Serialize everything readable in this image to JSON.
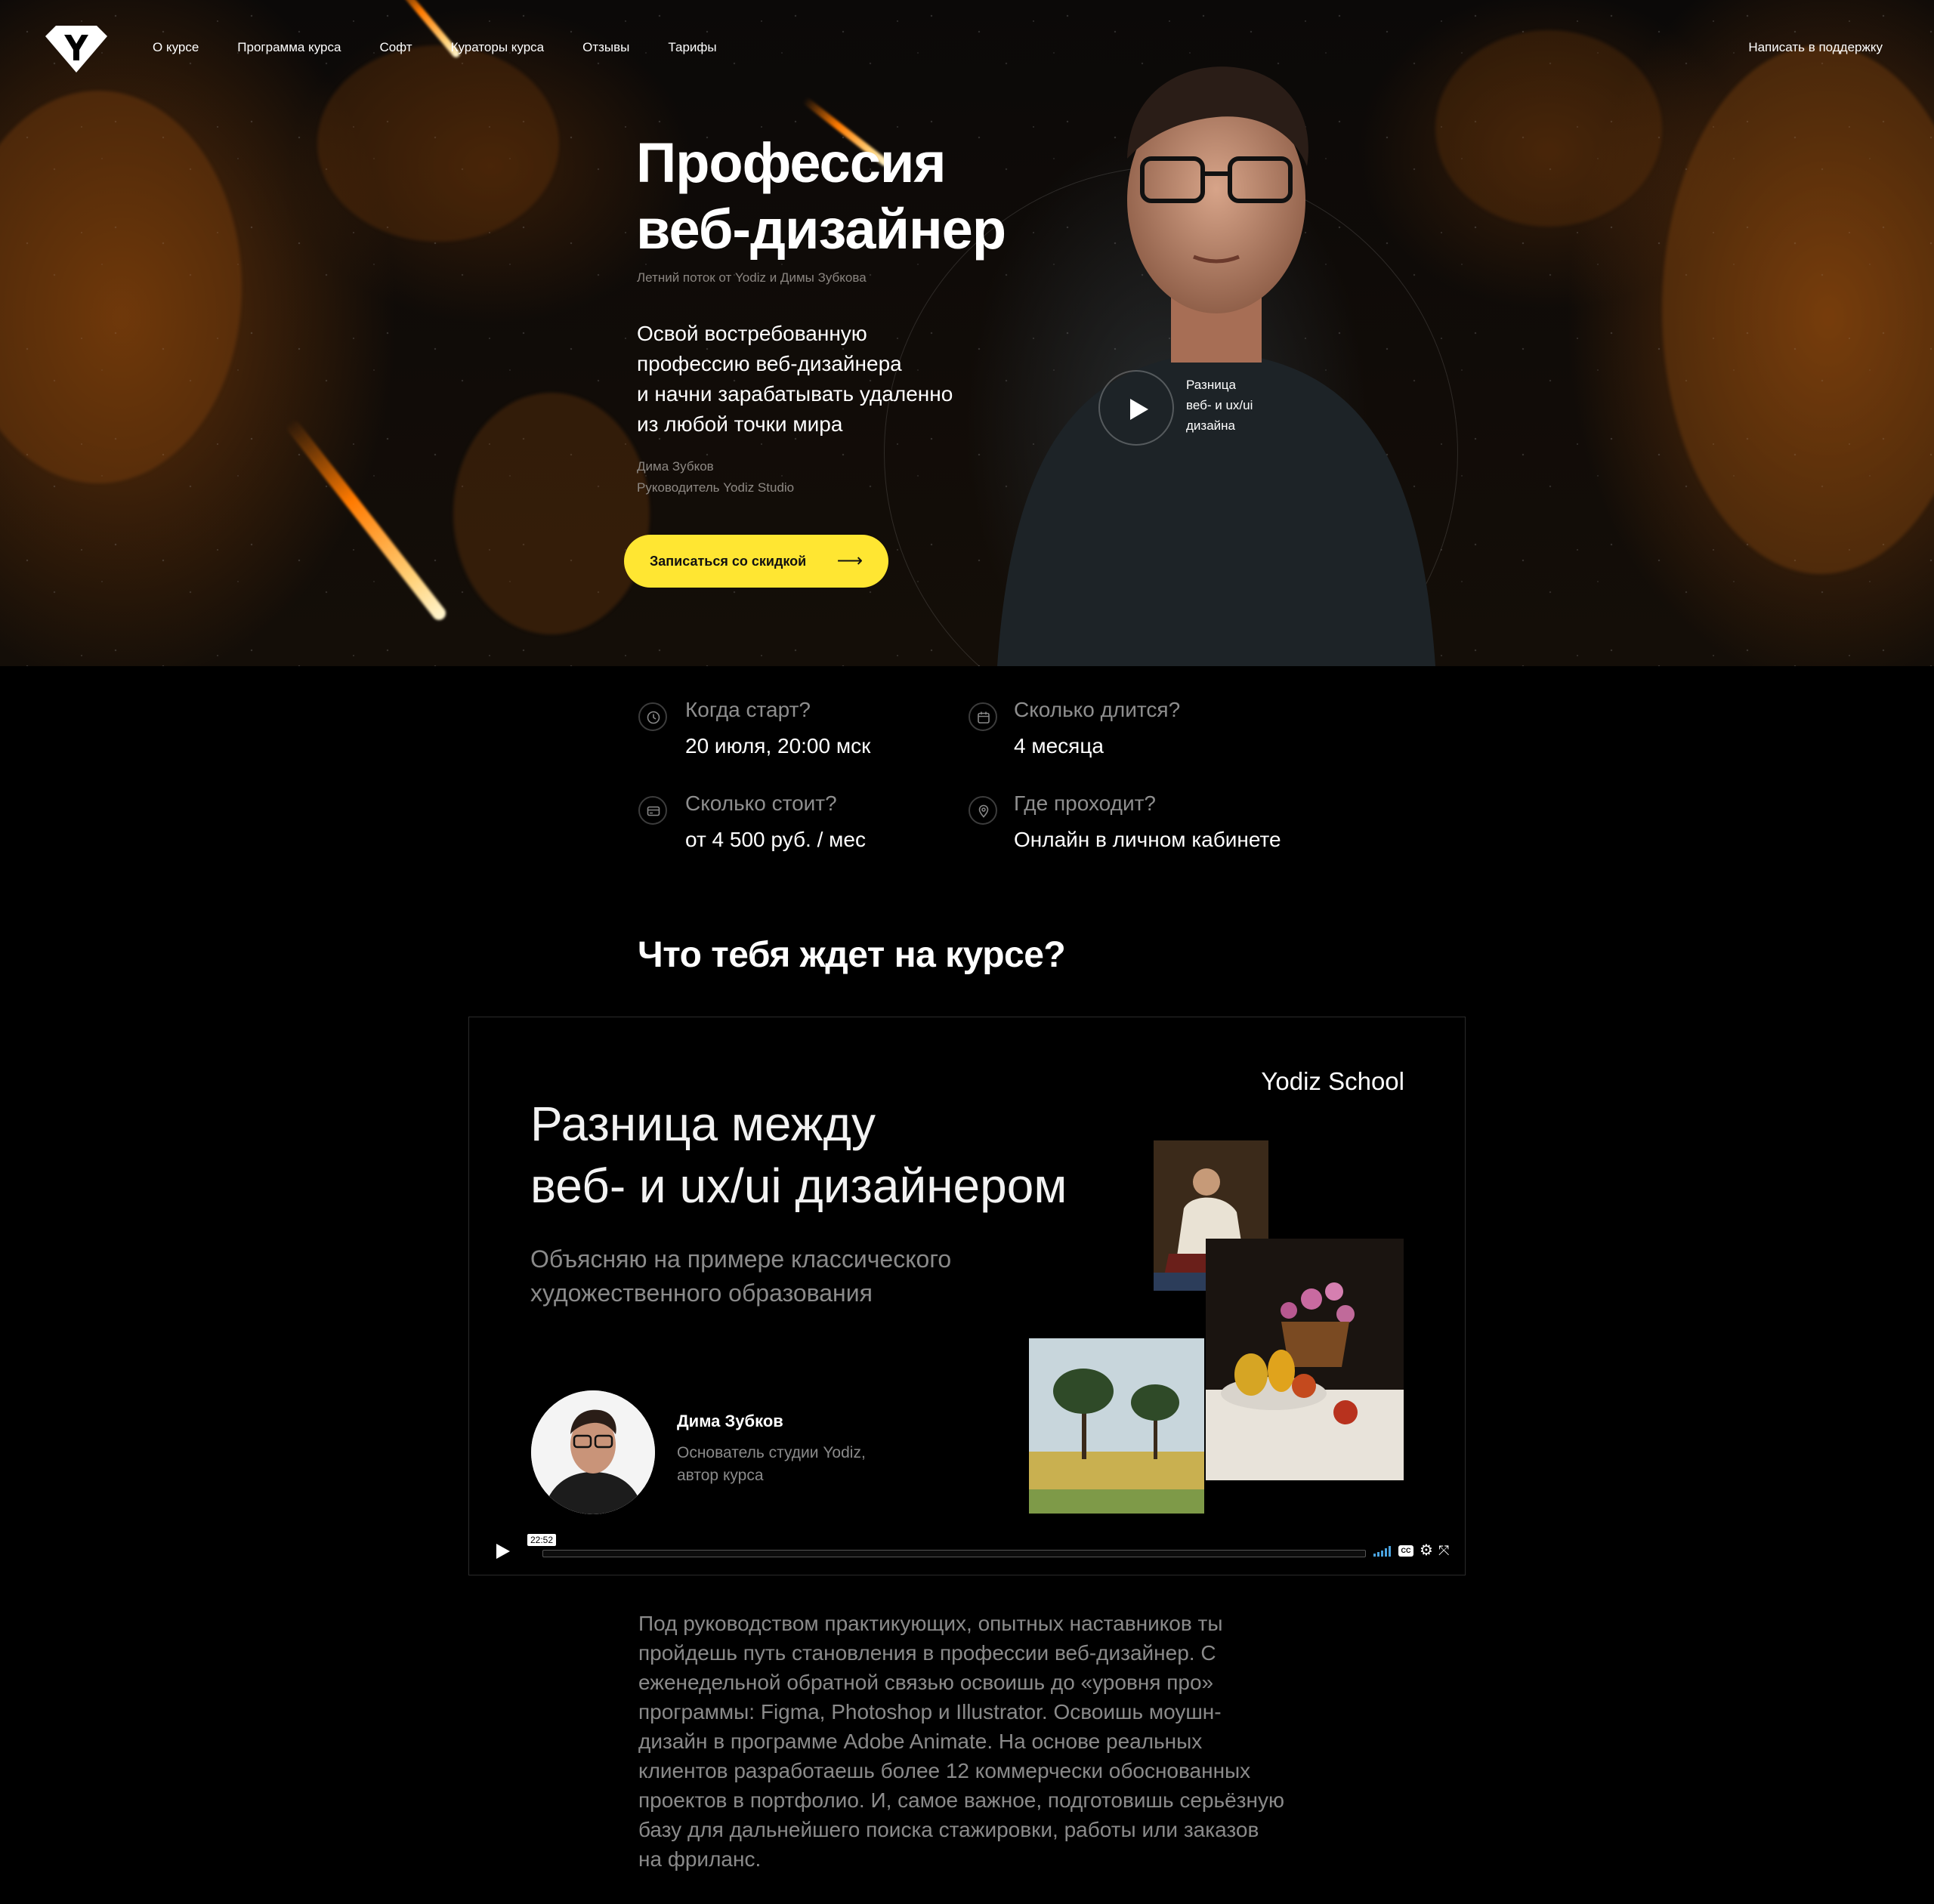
{
  "nav": {
    "items": [
      "О курсе",
      "Программа курса",
      "Софт",
      "Кураторы курса",
      "Отзывы",
      "Тарифы"
    ],
    "support": "Написать в поддержку"
  },
  "hero": {
    "title_line1": "Профессия",
    "title_line2": "веб-дизайнер",
    "subtitle": "Летний поток от Yodiz и Димы Зубкова",
    "lead": [
      "Освой востребованную",
      "профессию веб-дизайнера",
      "и начни зарабатывать удаленно",
      "из любой точки мира"
    ],
    "author_name": "Дима Зубков",
    "author_role": "Руководитель Yodiz Studio",
    "cta_label": "Записаться со скидкой",
    "cta_arrow": "⟶",
    "video_label": [
      "Разница",
      "веб- и ux/ui",
      "дизайна"
    ]
  },
  "info": {
    "start_q": "Когда старт?",
    "start_a": "20 июля, 20:00 мск",
    "duration_q": "Сколько длится?",
    "duration_a": "4 месяца",
    "price_q": "Сколько стоит?",
    "price_a": "от 4 500 руб. / мес",
    "place_q": "Где проходит?",
    "place_a": "Онлайн в личном кабинете"
  },
  "section": {
    "title": "Что тебя ждет на курсе?"
  },
  "video": {
    "title_line1": "Разница между",
    "title_line2": "веб- и ux/ui дизайнером",
    "sub_line1": "Объясняю на примере классического",
    "sub_line2": "художественного образования",
    "brand": "Yodiz School",
    "speaker_name": "Дима Зубков",
    "speaker_role1": "Основатель студии Yodiz,",
    "speaker_role2": "автор курса",
    "time": "22:52",
    "cc": "CC"
  },
  "description": "Под руководством практикующих, опытных наставников ты пройдешь путь становления в профессии веб-дизайнер. С еженедельной обратной связью освоишь до «уровня про» программы: Figma, Photoshop и Illustrator. Освоишь моушн-дизайн в программе Adobe Animate. На основе реальных клиентов разработаешь более 12 коммерчески обоснованных проектов в портфолио. И, самое важное, подготовишь серьёзную базу для дальнейшего поиска стажировки, работы или заказов на фриланс.",
  "colors": {
    "accent": "#ffe632",
    "muted": "#8a8a8a",
    "background": "#000000"
  },
  "icons": [
    "logo-icon",
    "clock-icon",
    "calendar-icon",
    "card-icon",
    "location-icon",
    "play-icon",
    "arrow-right-icon",
    "volume-icon",
    "cc-icon",
    "gear-icon",
    "fullscreen-icon"
  ]
}
